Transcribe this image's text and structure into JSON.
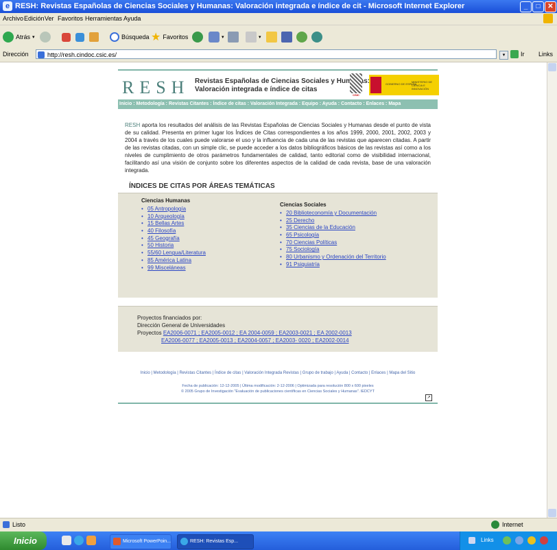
{
  "window": {
    "title": "RESH: Revistas Españolas de Ciencias Sociales y Humanas:   Valoración integrada e índice de cit - Microsoft Internet Explorer",
    "minimize": "_",
    "maximize": "□",
    "close": "✕"
  },
  "menu": [
    "Archivo",
    "Edición",
    "Ver",
    "Favoritos",
    "Herramientas",
    "Ayuda"
  ],
  "toolbar": {
    "back": "Atrás",
    "search": "Búsqueda",
    "favorites": "Favoritos"
  },
  "address": {
    "label": "Dirección",
    "url": "http://resh.cindoc.csic.es/",
    "go": "Ir",
    "links": "Links"
  },
  "site": {
    "logo": "RESH",
    "title_line1": "Revistas Españolas de Ciencias Sociales y Humanas:",
    "title_line2": "Valoración integrada e índice de citas",
    "csic": "CSIC",
    "gob1": "GOBIERNO DE ESPAÑA",
    "gob2": "MINISTERIO DE CIENCIA E INNOVACIÓN",
    "nav": "Inicio : Metodología : Revistas Citantes : Índice de citas : Valoración Integrada : Equipo : Ayuda : Contacto : Enlaces : Mapa",
    "intro_resh": "RESH",
    "intro_text": " aporta los resultados del análisis de las Revistas Españolas de Ciencias Sociales y Humanas desde el punto de vista de su calidad. Presenta en primer lugar los Índices de Citas correspondientes a los años 1999, 2000, 2001, 2002, 2003 y 2004 a través de los cuales puede valorarse el uso y la influencia de cada una de las revistas que aparecen citadas. A partir de las revistas citadas, con un simple clic, se puede acceder a los datos bibliográficos básicos de las revistas así como a los niveles de cumplimiento de otros parámetros fundamentales de calidad, tanto editorial como de visibilidad internacional, facilitando así una visión de conjunto sobre los diferentes aspectos de la calidad de cada revista, base de una valoración integrada.",
    "section_heading": "ÍNDICES DE CITAS POR ÁREAS TEMÁTICAS",
    "humanas_title": "Ciencias Humanas",
    "humanas": [
      "05 Antropología",
      "10 Arqueología",
      "15 Bellas Artes",
      "40 Filosofía",
      "45 Geografía",
      "50 Historia",
      "55/60 Lengua/Literatura",
      "85 América Latina",
      "99 Misceláneas"
    ],
    "sociales_title": "Ciencias Sociales",
    "sociales": [
      "20 Biblioteconomía y Documentación",
      "25 Derecho",
      "35 Ciencias de la Educación",
      "65 Psicología",
      "70 Ciencias Políticas",
      "75 Sociología",
      "80 Urbanismo y Ordenación del Territorio",
      "91 Psiquiatría"
    ],
    "funding_label": "Proyectos financiados por:",
    "funding_org": "Dirección General de Universidades",
    "projects_label": "Proyectos",
    "projects_line1": "EA2006-0071 ; EA2005-0012 ; EA 2004-0059 ; EA2003-0021 ; EA 2002-0013",
    "projects_line2": "EA2006-0077 ; EA2005-0013 ; EA2004-0057 ; EA2003- 0020 ; EA2002-0014",
    "footer_links": "Inicio | Metodología | Revistas Citantes | Índice de citas | Valoración Integrada Revistas | Grupo de trabajo | Ayuda | Contacto | Enlaces | Mapa del Sitio",
    "footer_line1": "Fecha de publicación: 12-12-2005 | Última modificación: 2-12-2006 | Optimizada para resolución 800 x 600 pixeles",
    "footer_line2": "© 2005 Grupo de Investigación \"Evaluación de publicaciones científicas en Ciencias Sociales y Humanas\". IEDCYT"
  },
  "status": {
    "text": "Listo",
    "zone": "Internet"
  },
  "taskbar": {
    "start": "Inicio",
    "task1": "Microsoft PowerPoin...",
    "task2": "RESH: Revistas Esp...",
    "tray_links": "Links"
  }
}
